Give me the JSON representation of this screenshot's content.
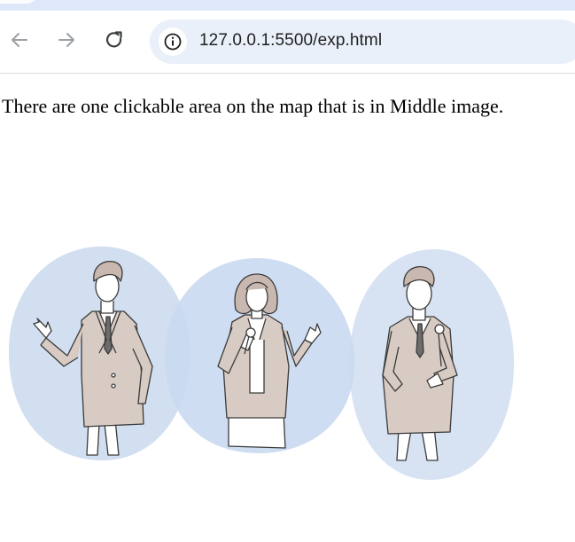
{
  "browser": {
    "url": "127.0.0.1:5500/exp.html",
    "icons": {
      "back": "arrow-left-icon",
      "forward": "arrow-right-icon",
      "reload": "reload-icon",
      "site_info": "info-icon"
    }
  },
  "page": {
    "instruction": "There are one clickable area on the map that is in Middle image."
  },
  "image_map": {
    "clickable_area": "middle"
  },
  "colors": {
    "tab_strip": "#dfe8fb",
    "omnibox": "#eaf0fa",
    "blob": "#c9d9ef",
    "jacket": "#d8cbc3",
    "outline": "#3a3a3a"
  }
}
